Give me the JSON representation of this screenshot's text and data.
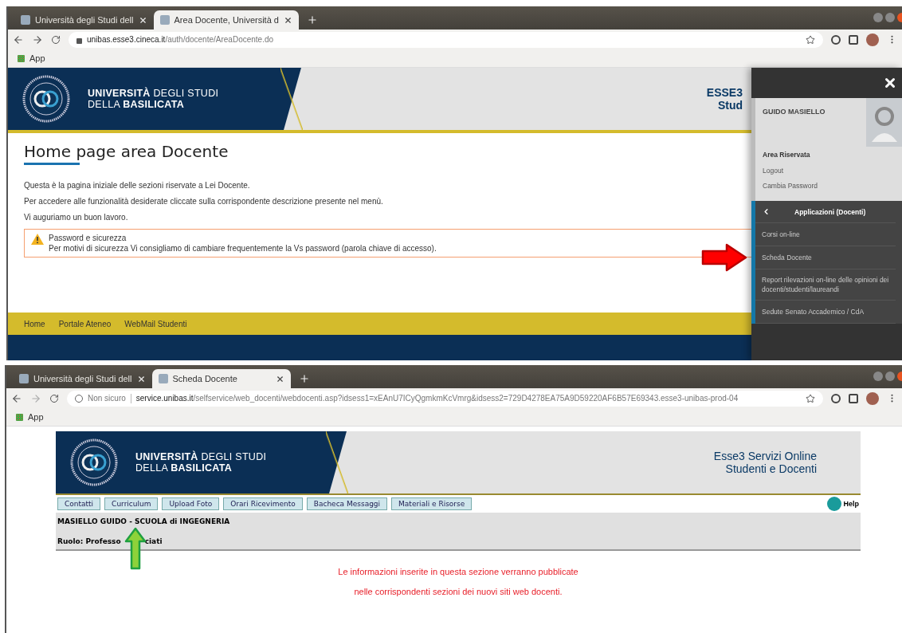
{
  "top_window": {
    "browser": {
      "tabs": [
        {
          "title": "Università degli Studi dell",
          "selected": false
        },
        {
          "title": "Area Docente, Università d",
          "selected": true
        }
      ],
      "address": {
        "kind": "secure",
        "host": "unibas.esse3.cineca.it",
        "path": "/auth/docente/AreaDocente.do"
      },
      "bookmarks": [
        "App"
      ]
    },
    "page": {
      "brand": [
        "**UNIVERSITÀ** DEGLI STUDI",
        "DELLA **BASILICATA**"
      ],
      "header_right": [
        "ESSE3",
        "Stud"
      ],
      "title": "Home page area Docente",
      "paragraphs": [
        "Questa è la pagina iniziale delle sezioni riservate a Lei Docente.",
        "Per accedere alle funzionalità desiderate cliccate sulla corrispondente descrizione presente nel menù.",
        "Vi auguriamo un buon lavoro."
      ],
      "alert": {
        "title": "Password e sicurezza",
        "text": "Per motivi di sicurezza Vi consigliamo di cambiare frequentemente la Vs password (parola chiave di accesso)."
      },
      "footer_links": [
        "Home",
        "Portale Ateneo",
        "WebMail Studenti"
      ]
    },
    "side_panel": {
      "user_name": "GUIDO MASIELLO",
      "section_title": "Area Riservata",
      "links": [
        "Logout",
        "Cambia Password"
      ],
      "menu_title": "Applicazioni (Docenti)",
      "menu_items": [
        "Corsi on-line",
        "Scheda Docente",
        "Report rilevazioni on-line delle opinioni dei docenti/studenti/laureandi",
        "Sedute Senato Accademico / CdA"
      ]
    }
  },
  "bottom_window": {
    "browser": {
      "tabs": [
        {
          "title": "Università degli Studi dell",
          "selected": false
        },
        {
          "title": "Scheda Docente",
          "selected": true
        }
      ],
      "address": {
        "kind": "insecure",
        "label": "Non sicuro",
        "host": "service.unibas.it",
        "path": "/selfservice/web_docenti/webdocenti.asp?idsess1=xEAnU7ICyQgmkmKcVmrg&idsess2=729D4278EA75A9D59220AF6B57E69343.esse3-unibas-prod-04"
      },
      "bookmarks": [
        "App"
      ]
    },
    "page": {
      "brand": [
        "**UNIVERSITÀ** DEGLI STUDI",
        "DELLA **BASILICATA**"
      ],
      "service_lines": [
        "Esse3 Servizi Online",
        "Studenti e Docenti"
      ],
      "nav_buttons": [
        "Contatti",
        "Curriculum",
        "Upload Foto",
        "Orari Ricevimento",
        "Bacheca Messaggi",
        "Materiali e Risorse"
      ],
      "help": "Help",
      "info": {
        "name_line": "MASIELLO GUIDO - SCUOLA di INGEGNERIA",
        "role_start": "Ruolo: Professo",
        "role_end": "ciati"
      },
      "notice": [
        "Le informazioni inserite in questa sezione verranno pubblicate",
        "nelle corrispondenti sezioni dei nuovi siti web docenti."
      ]
    }
  }
}
